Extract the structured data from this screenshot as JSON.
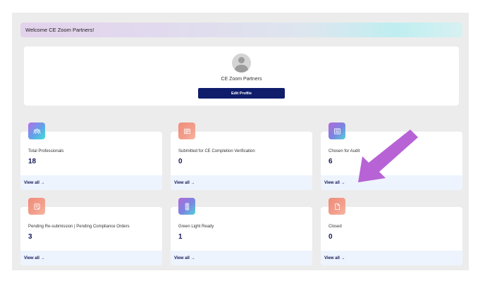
{
  "welcome": {
    "text": "Welcome CE Zoom Partners!"
  },
  "profile": {
    "avatar_icon": "user-avatar-icon",
    "name": "CE Zoom Partners",
    "edit_label": "Edit Profile"
  },
  "cards": [
    {
      "icon": "users-group-icon",
      "label": "Total Professionals",
      "value": "18",
      "link": "View all →"
    },
    {
      "icon": "verify-list-icon",
      "label": "Submitted for CE Completion Verification",
      "value": "0",
      "link": "View all →"
    },
    {
      "icon": "checklist-icon",
      "label": "Chosen for Audit",
      "value": "6",
      "link": "View all →"
    },
    {
      "icon": "resubmit-doc-icon",
      "label": "Pending Re-submission | Pending Compliance Orders",
      "value": "3",
      "link": "View all →"
    },
    {
      "icon": "green-light-icon",
      "label": "Green Light Ready",
      "value": "1",
      "link": "View all →"
    },
    {
      "icon": "closed-doc-icon",
      "label": "Closed",
      "value": "0",
      "link": "View all →"
    }
  ],
  "colors": {
    "brand_navy": "#0f1d6b",
    "annotation_arrow": "#b763d6",
    "footer_bg": "#eef4fd"
  }
}
